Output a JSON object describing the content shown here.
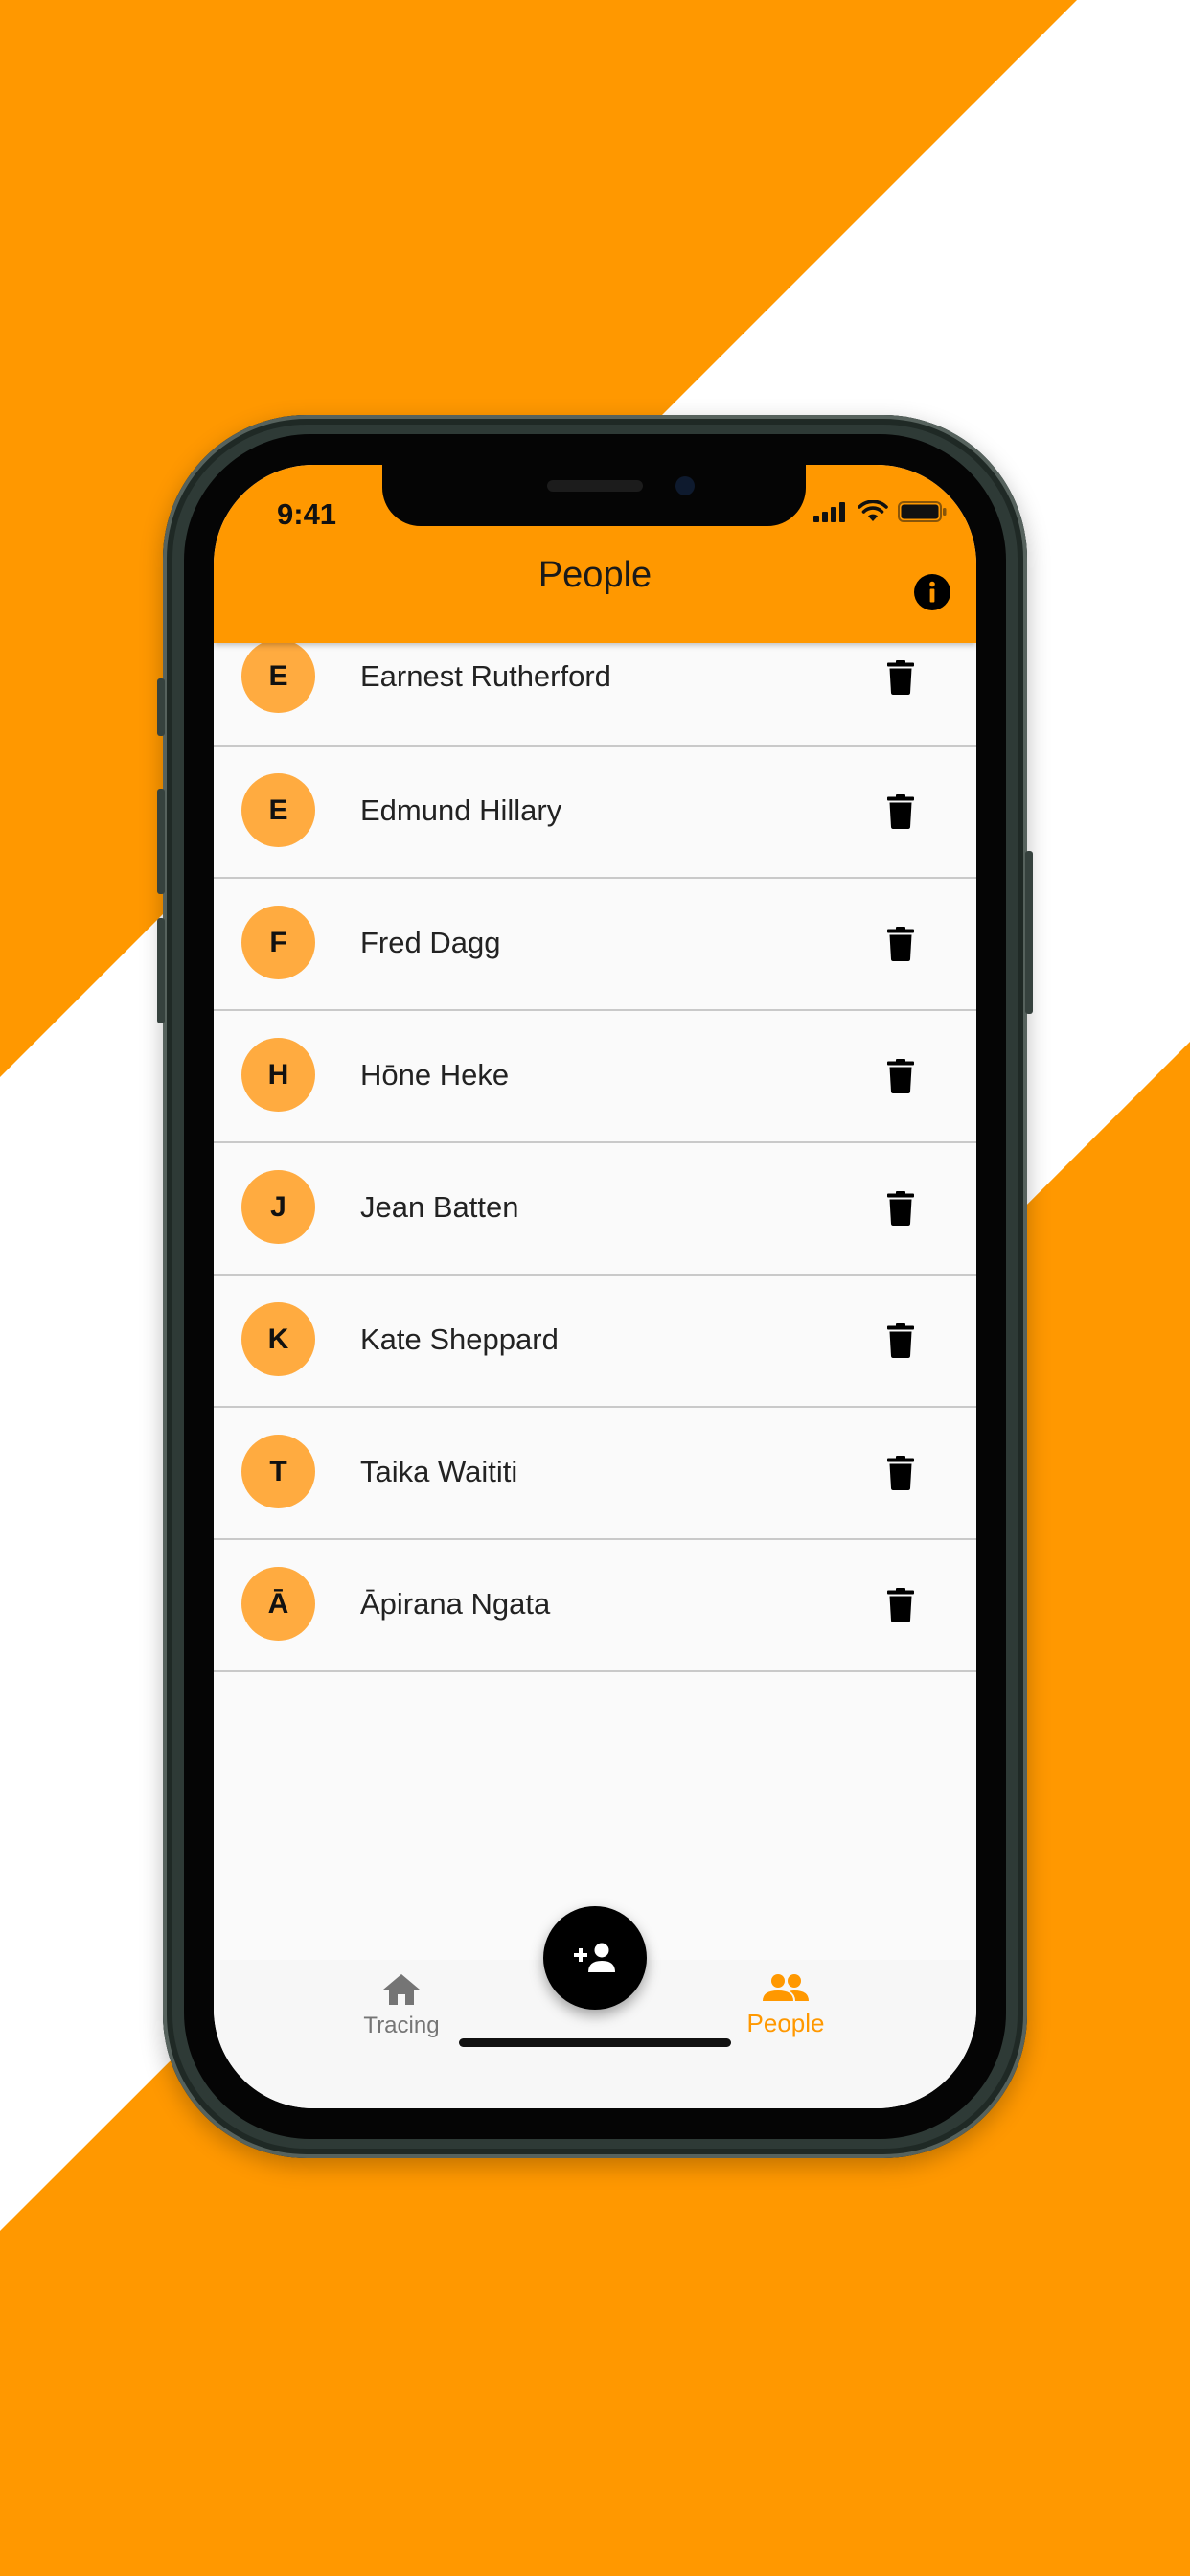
{
  "colors": {
    "accent": "#ff9800",
    "avatar": "#ffab40",
    "background_alt": "#ffffff",
    "nav_active": "#ff9800",
    "nav_inactive": "#757575"
  },
  "status_bar": {
    "time": "9:41",
    "icons": [
      "signal-icon",
      "wifi-icon",
      "battery-icon"
    ]
  },
  "app_bar": {
    "title": "People",
    "action_icon": "info-icon"
  },
  "people": [
    {
      "initial": "E",
      "name": "Earnest Rutherford"
    },
    {
      "initial": "E",
      "name": "Edmund Hillary"
    },
    {
      "initial": "F",
      "name": "Fred Dagg"
    },
    {
      "initial": "H",
      "name": "Hōne Heke"
    },
    {
      "initial": "J",
      "name": "Jean Batten"
    },
    {
      "initial": "K",
      "name": "Kate Sheppard"
    },
    {
      "initial": "T",
      "name": "Taika Waititi"
    },
    {
      "initial": "Ā",
      "name": "Āpirana Ngata"
    }
  ],
  "fab": {
    "icon": "add-person-icon"
  },
  "bottom_nav": {
    "items": [
      {
        "label": "Tracing",
        "icon": "home-icon",
        "active": false
      },
      {
        "label": "People",
        "icon": "people-icon",
        "active": true
      }
    ]
  }
}
